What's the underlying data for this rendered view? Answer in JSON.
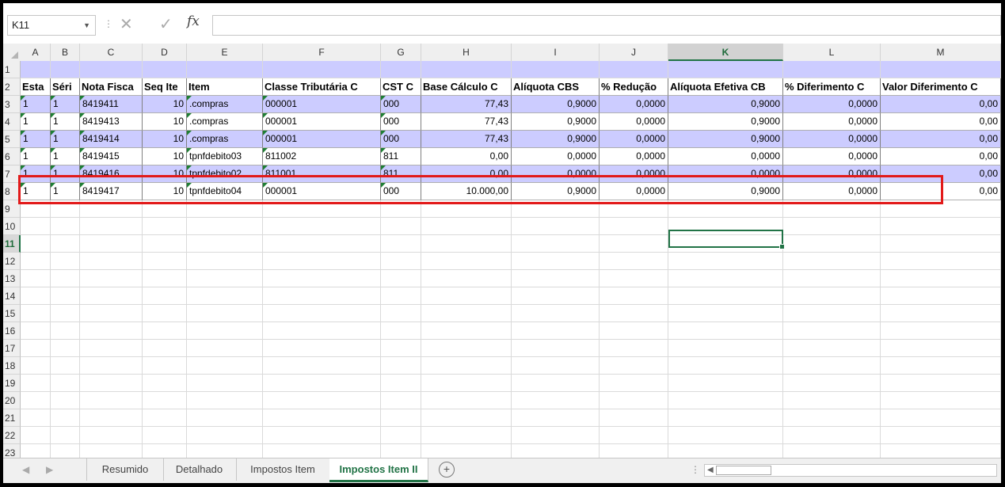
{
  "formula_bar": {
    "name_box": "K11",
    "fx_label": "fx",
    "formula": ""
  },
  "columns": [
    "A",
    "B",
    "C",
    "D",
    "E",
    "F",
    "G",
    "H",
    "I",
    "J",
    "K",
    "L",
    "M"
  ],
  "selected_column": "K",
  "row_numbers": [
    "1",
    "2",
    "3",
    "4",
    "5",
    "6",
    "7",
    "8",
    "9",
    "10",
    "11",
    "12",
    "13",
    "14",
    "15",
    "16",
    "17",
    "18",
    "19",
    "20",
    "21",
    "22",
    "23"
  ],
  "selected_row": "11",
  "table": {
    "headers": [
      "Esta",
      "Séri",
      "Nota Fisca",
      "Seq Ite",
      "Item",
      "Classe Tributária C",
      "CST C",
      "Base Cálculo C",
      "Alíquota CBS",
      "% Redução",
      "Alíquota Efetiva CB",
      "% Diferimento C",
      "Valor Diferimento C"
    ],
    "rows": [
      [
        "1",
        "1",
        "8419411",
        "10",
        ".compras",
        "000001",
        "000",
        "77,43",
        "0,9000",
        "0,0000",
        "0,9000",
        "0,0000",
        "0,00"
      ],
      [
        "1",
        "1",
        "8419413",
        "10",
        ".compras",
        "000001",
        "000",
        "77,43",
        "0,9000",
        "0,0000",
        "0,9000",
        "0,0000",
        "0,00"
      ],
      [
        "1",
        "1",
        "8419414",
        "10",
        ".compras",
        "000001",
        "000",
        "77,43",
        "0,9000",
        "0,0000",
        "0,9000",
        "0,0000",
        "0,00"
      ],
      [
        "1",
        "1",
        "8419415",
        "10",
        "tpnfdebito03",
        "811002",
        "811",
        "0,00",
        "0,0000",
        "0,0000",
        "0,0000",
        "0,0000",
        "0,00"
      ],
      [
        "1",
        "1",
        "8419416",
        "10",
        "tpnfdebito02",
        "811001",
        "811",
        "0,00",
        "0,0000",
        "0,0000",
        "0,0000",
        "0,0000",
        "0,00"
      ],
      [
        "1",
        "1",
        "8419417",
        "10",
        "tpnfdebito04",
        "000001",
        "000",
        "10.000,00",
        "0,9000",
        "0,0000",
        "0,9000",
        "0,0000",
        "0,00"
      ]
    ]
  },
  "sheet_tabs": [
    "Resumido",
    "Detalhado",
    "Impostos Item",
    "Impostos Item II"
  ],
  "active_tab": "Impostos Item II",
  "colors": {
    "band": "#ccccff",
    "accent": "#217346",
    "highlight": "#e21a1a"
  }
}
